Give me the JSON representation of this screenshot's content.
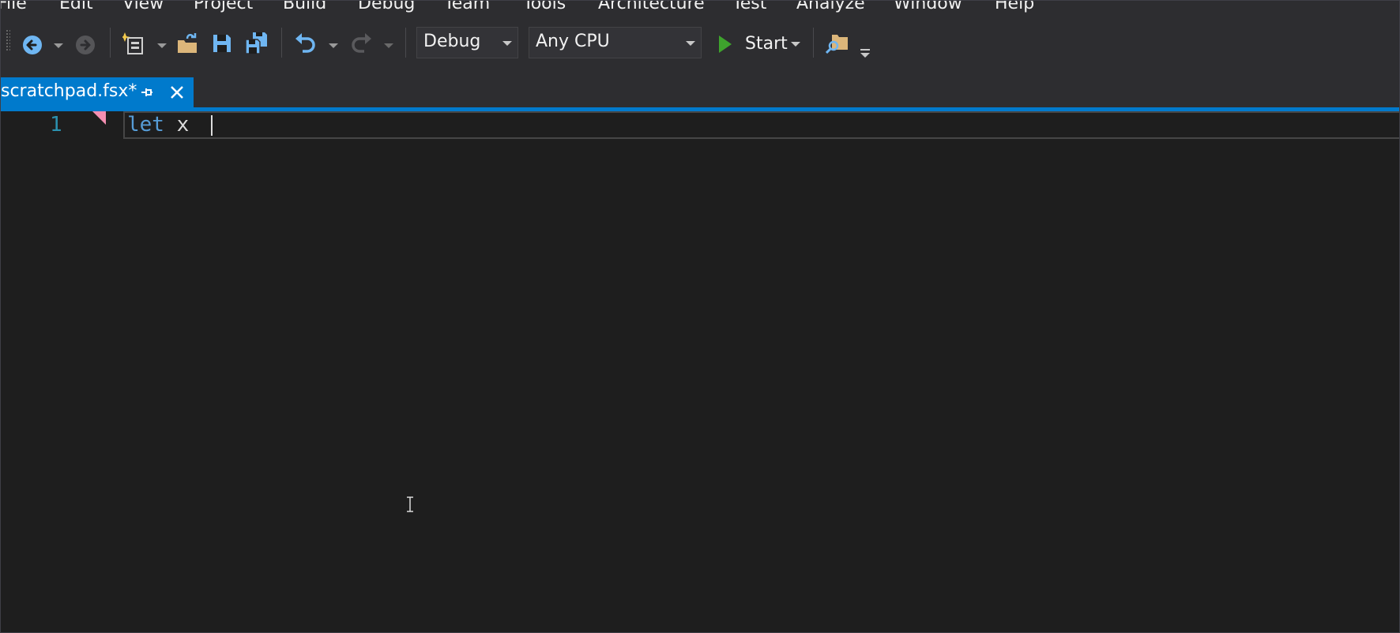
{
  "menu": {
    "items": [
      "File",
      "Edit",
      "View",
      "Project",
      "Build",
      "Debug",
      "Team",
      "Tools",
      "Architecture",
      "Test",
      "Analyze",
      "Window",
      "Help"
    ]
  },
  "toolbar": {
    "configuration": "Debug",
    "platform": "Any CPU",
    "start_label": "Start",
    "icons": [
      "navigate-back-icon",
      "navigate-forward-icon",
      "new-project-icon",
      "open-file-icon",
      "save-icon",
      "save-all-icon",
      "undo-icon",
      "redo-icon",
      "start-icon",
      "find-in-files-icon"
    ]
  },
  "tabs": [
    {
      "label": "scratchpad.fsx*",
      "active": true
    }
  ],
  "editor": {
    "line_number": "1",
    "keyword": "let",
    "identifier": "x"
  },
  "colors": {
    "accent": "#007acc",
    "background": "#1e1e1e",
    "chrome": "#2d2d30",
    "keyword": "#569cd6",
    "line_number": "#2b91af",
    "start_green": "#3ea32d",
    "error_mark": "#f48fb1"
  }
}
